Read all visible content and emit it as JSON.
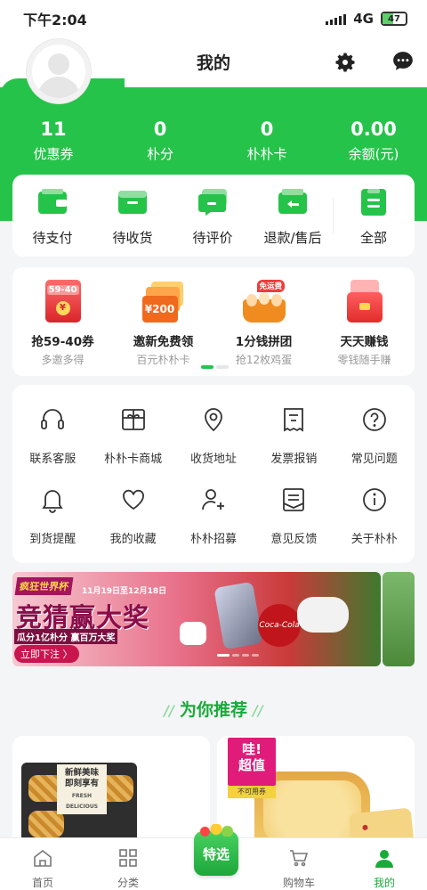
{
  "status_bar": {
    "time": "下午2:04",
    "network": "4G",
    "battery": "47",
    "battery_fraction": 0.47
  },
  "header": {
    "title": "我的"
  },
  "stats": [
    {
      "value": "11",
      "label": "优惠券"
    },
    {
      "value": "0",
      "label": "朴分"
    },
    {
      "value": "0",
      "label": "朴朴卡"
    },
    {
      "value": "0.00",
      "label": "余额(元)"
    }
  ],
  "orders": [
    {
      "label": "待支付"
    },
    {
      "label": "待收货"
    },
    {
      "label": "待评价"
    },
    {
      "label": "退款/售后"
    },
    {
      "label": "全部"
    }
  ],
  "promos": [
    {
      "title": "抢59-40券",
      "subtitle": "多邀多得",
      "art": "59-40"
    },
    {
      "title": "邀新免费领",
      "subtitle": "百元朴朴卡",
      "art": "¥200"
    },
    {
      "title": "1分钱拼团",
      "subtitle": "抢12枚鸡蛋",
      "art": "免运费"
    },
    {
      "title": "天天赚钱",
      "subtitle": "零钱随手赚",
      "art": ""
    }
  ],
  "services": [
    {
      "label": "联系客服",
      "icon": "headset-icon"
    },
    {
      "label": "朴朴卡商城",
      "icon": "gift-card-icon"
    },
    {
      "label": "收货地址",
      "icon": "location-icon"
    },
    {
      "label": "发票报销",
      "icon": "invoice-icon"
    },
    {
      "label": "常见问题",
      "icon": "question-icon"
    },
    {
      "label": "到货提醒",
      "icon": "bell-icon"
    },
    {
      "label": "我的收藏",
      "icon": "heart-icon"
    },
    {
      "label": "朴朴招募",
      "icon": "add-user-icon"
    },
    {
      "label": "意见反馈",
      "icon": "feedback-icon"
    },
    {
      "label": "关于朴朴",
      "icon": "info-icon"
    }
  ],
  "banner": {
    "tag": "疯狂世界杯",
    "date": "11月19日至12月18日",
    "headline": "竞猜赢大奖",
    "sub": "瓜分1亿朴分 赢百万大奖",
    "button": "立即下注 〉",
    "can_text": "Coca-Cola"
  },
  "recommend": {
    "title": "为你推荐"
  },
  "products": [
    {
      "label_cn_1": "新鲜美味",
      "label_cn_2": "即刻享有",
      "label_en": "FRESH DELICIOUS"
    },
    {
      "badge_1": "哇!",
      "badge_2": "超值",
      "badge_note": "不可用券"
    }
  ],
  "tabs": [
    {
      "label": "首页",
      "icon": "home-icon"
    },
    {
      "label": "分类",
      "icon": "grid-icon"
    },
    {
      "label": "特选",
      "icon": "basket-icon"
    },
    {
      "label": "购物车",
      "icon": "cart-icon"
    },
    {
      "label": "我的",
      "icon": "user-icon",
      "active": true
    }
  ],
  "colors": {
    "brand_green": "#26c34a",
    "active_tab": "#1aaa3a"
  }
}
